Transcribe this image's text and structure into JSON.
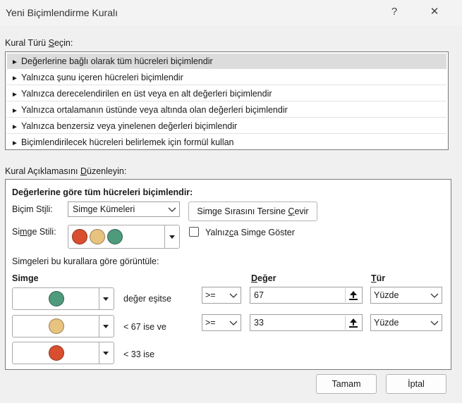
{
  "window": {
    "title": "Yeni Biçimlendirme Kuralı",
    "help": "?",
    "close": "✕"
  },
  "rule_type": {
    "label": "Kural Türü Seçin:",
    "items": [
      "Değerlerine bağlı olarak tüm hücreleri biçimlendir",
      "Yalnızca şunu içeren hücreleri biçimlendir",
      "Yalnızca derecelendirilen en üst veya en alt değerleri biçimlendir",
      "Yalnızca ortalamanın üstünde veya altında olan değerleri biçimlendir",
      "Yalnızca benzersiz veya yinelenen değerleri biçimlendir",
      "Biçimlendirilecek hücreleri belirlemek için formül kullan"
    ],
    "selected_index": 0
  },
  "edit": {
    "label": "Kural Açıklamasını Düzenleyin:",
    "heading": "Değerlerine göre tüm hücreleri biçimlendir:",
    "format_style_label": "Biçim Stili:",
    "format_style_value": "Simge Kümeleri",
    "reverse_button": "Simge Sırasını Tersine Çevir",
    "icon_style_label": "Simge Stili:",
    "icon_style_colors": [
      "#d94e2f",
      "#e8c27f",
      "#4e9a7c"
    ],
    "show_icon_only": "Yalnızca Simge Göster",
    "show_icon_only_checked": false,
    "rules_label": "Simgeleri bu kurallara göre görüntüle:",
    "col_icon": "Simge",
    "col_value": "Değer",
    "col_type": "Tür",
    "rows": [
      {
        "icon_color": "#4e9a7c",
        "condition": "değer eşitse",
        "operator": ">=",
        "value": "67",
        "type": "Yüzde"
      },
      {
        "icon_color": "#e8c27f",
        "condition": "< 67 ise ve",
        "operator": ">=",
        "value": "33",
        "type": "Yüzde"
      },
      {
        "icon_color": "#d94e2f",
        "condition": "< 33 ise"
      }
    ]
  },
  "footer": {
    "ok": "Tamam",
    "cancel": "İptal"
  }
}
